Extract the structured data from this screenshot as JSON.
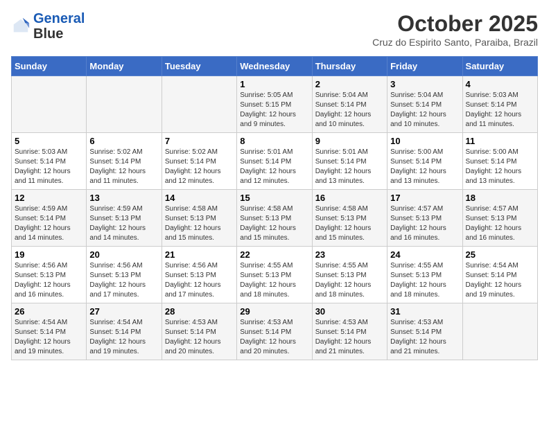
{
  "header": {
    "logo_line1": "General",
    "logo_line2": "Blue",
    "month": "October 2025",
    "location": "Cruz do Espirito Santo, Paraiba, Brazil"
  },
  "days_of_week": [
    "Sunday",
    "Monday",
    "Tuesday",
    "Wednesday",
    "Thursday",
    "Friday",
    "Saturday"
  ],
  "weeks": [
    [
      {
        "day": "",
        "info": ""
      },
      {
        "day": "",
        "info": ""
      },
      {
        "day": "",
        "info": ""
      },
      {
        "day": "1",
        "info": "Sunrise: 5:05 AM\nSunset: 5:15 PM\nDaylight: 12 hours\nand 9 minutes."
      },
      {
        "day": "2",
        "info": "Sunrise: 5:04 AM\nSunset: 5:14 PM\nDaylight: 12 hours\nand 10 minutes."
      },
      {
        "day": "3",
        "info": "Sunrise: 5:04 AM\nSunset: 5:14 PM\nDaylight: 12 hours\nand 10 minutes."
      },
      {
        "day": "4",
        "info": "Sunrise: 5:03 AM\nSunset: 5:14 PM\nDaylight: 12 hours\nand 11 minutes."
      }
    ],
    [
      {
        "day": "5",
        "info": "Sunrise: 5:03 AM\nSunset: 5:14 PM\nDaylight: 12 hours\nand 11 minutes."
      },
      {
        "day": "6",
        "info": "Sunrise: 5:02 AM\nSunset: 5:14 PM\nDaylight: 12 hours\nand 11 minutes."
      },
      {
        "day": "7",
        "info": "Sunrise: 5:02 AM\nSunset: 5:14 PM\nDaylight: 12 hours\nand 12 minutes."
      },
      {
        "day": "8",
        "info": "Sunrise: 5:01 AM\nSunset: 5:14 PM\nDaylight: 12 hours\nand 12 minutes."
      },
      {
        "day": "9",
        "info": "Sunrise: 5:01 AM\nSunset: 5:14 PM\nDaylight: 12 hours\nand 13 minutes."
      },
      {
        "day": "10",
        "info": "Sunrise: 5:00 AM\nSunset: 5:14 PM\nDaylight: 12 hours\nand 13 minutes."
      },
      {
        "day": "11",
        "info": "Sunrise: 5:00 AM\nSunset: 5:14 PM\nDaylight: 12 hours\nand 13 minutes."
      }
    ],
    [
      {
        "day": "12",
        "info": "Sunrise: 4:59 AM\nSunset: 5:14 PM\nDaylight: 12 hours\nand 14 minutes."
      },
      {
        "day": "13",
        "info": "Sunrise: 4:59 AM\nSunset: 5:13 PM\nDaylight: 12 hours\nand 14 minutes."
      },
      {
        "day": "14",
        "info": "Sunrise: 4:58 AM\nSunset: 5:13 PM\nDaylight: 12 hours\nand 15 minutes."
      },
      {
        "day": "15",
        "info": "Sunrise: 4:58 AM\nSunset: 5:13 PM\nDaylight: 12 hours\nand 15 minutes."
      },
      {
        "day": "16",
        "info": "Sunrise: 4:58 AM\nSunset: 5:13 PM\nDaylight: 12 hours\nand 15 minutes."
      },
      {
        "day": "17",
        "info": "Sunrise: 4:57 AM\nSunset: 5:13 PM\nDaylight: 12 hours\nand 16 minutes."
      },
      {
        "day": "18",
        "info": "Sunrise: 4:57 AM\nSunset: 5:13 PM\nDaylight: 12 hours\nand 16 minutes."
      }
    ],
    [
      {
        "day": "19",
        "info": "Sunrise: 4:56 AM\nSunset: 5:13 PM\nDaylight: 12 hours\nand 16 minutes."
      },
      {
        "day": "20",
        "info": "Sunrise: 4:56 AM\nSunset: 5:13 PM\nDaylight: 12 hours\nand 17 minutes."
      },
      {
        "day": "21",
        "info": "Sunrise: 4:56 AM\nSunset: 5:13 PM\nDaylight: 12 hours\nand 17 minutes."
      },
      {
        "day": "22",
        "info": "Sunrise: 4:55 AM\nSunset: 5:13 PM\nDaylight: 12 hours\nand 18 minutes."
      },
      {
        "day": "23",
        "info": "Sunrise: 4:55 AM\nSunset: 5:13 PM\nDaylight: 12 hours\nand 18 minutes."
      },
      {
        "day": "24",
        "info": "Sunrise: 4:55 AM\nSunset: 5:13 PM\nDaylight: 12 hours\nand 18 minutes."
      },
      {
        "day": "25",
        "info": "Sunrise: 4:54 AM\nSunset: 5:14 PM\nDaylight: 12 hours\nand 19 minutes."
      }
    ],
    [
      {
        "day": "26",
        "info": "Sunrise: 4:54 AM\nSunset: 5:14 PM\nDaylight: 12 hours\nand 19 minutes."
      },
      {
        "day": "27",
        "info": "Sunrise: 4:54 AM\nSunset: 5:14 PM\nDaylight: 12 hours\nand 19 minutes."
      },
      {
        "day": "28",
        "info": "Sunrise: 4:53 AM\nSunset: 5:14 PM\nDaylight: 12 hours\nand 20 minutes."
      },
      {
        "day": "29",
        "info": "Sunrise: 4:53 AM\nSunset: 5:14 PM\nDaylight: 12 hours\nand 20 minutes."
      },
      {
        "day": "30",
        "info": "Sunrise: 4:53 AM\nSunset: 5:14 PM\nDaylight: 12 hours\nand 21 minutes."
      },
      {
        "day": "31",
        "info": "Sunrise: 4:53 AM\nSunset: 5:14 PM\nDaylight: 12 hours\nand 21 minutes."
      },
      {
        "day": "",
        "info": ""
      }
    ]
  ]
}
